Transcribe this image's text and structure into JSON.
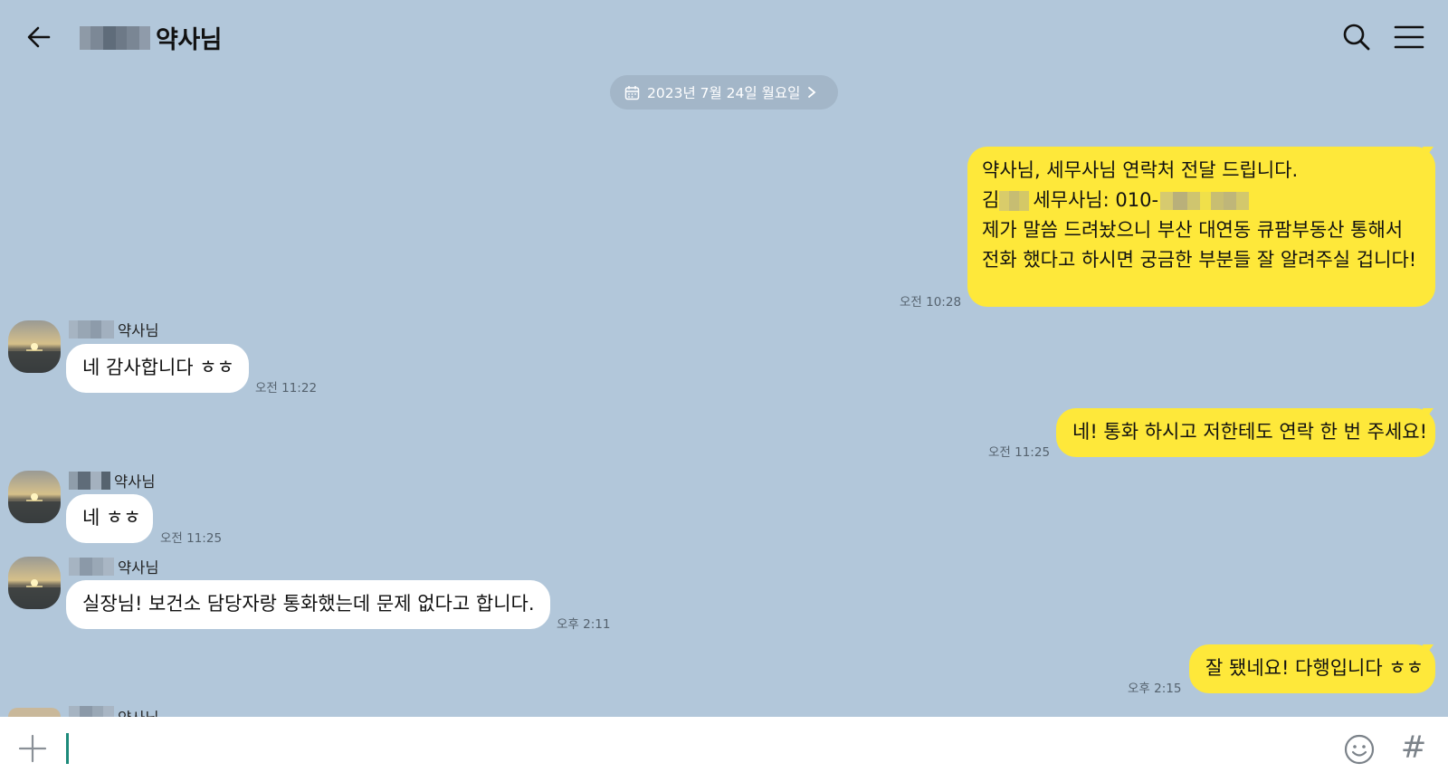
{
  "header": {
    "title": "약사님",
    "back_icon": "arrow-left-icon",
    "search_icon": "search-icon",
    "menu_icon": "hamburger-menu-icon"
  },
  "date_chip": {
    "label": "2023년 7월 24일 월요일",
    "icon": "calendar-icon"
  },
  "colors": {
    "background": "#b2c7da",
    "outgoing_bubble": "#fee83a",
    "incoming_bubble": "#ffffff",
    "time_text": "#55626e"
  },
  "messages": [
    {
      "side": "out",
      "lines": [
        "약사님, 세무사님 연락처 전달 드립니다.",
        "김",
        "세무사님: 010-",
        "제가 말씀 드려놨으니 부산 대연동 큐팜부동산 통해서",
        "전화 했다고 하시면 궁금한 부분들 잘 알려주실 겁니다!"
      ],
      "time": "오전 10:28"
    },
    {
      "side": "in",
      "sender": "약사님",
      "text": "네 감사합니다 ㅎㅎ",
      "time": "오전 11:22"
    },
    {
      "side": "out",
      "text": "네! 통화 하시고 저한테도 연락 한 번 주세요!",
      "time": "오전 11:25"
    },
    {
      "side": "in",
      "sender": "약사님",
      "text": "네 ㅎㅎ",
      "time": "오전 11:25"
    },
    {
      "side": "in",
      "sender": "약사님",
      "text": "실장님! 보건소 담당자랑 통화했는데 문제 없다고 합니다.",
      "time": "오후 2:11"
    },
    {
      "side": "out",
      "text": "잘 됐네요! 다행입니다 ㅎㅎ",
      "time": "오후 2:15"
    },
    {
      "side": "in",
      "sender": "약사님"
    }
  ],
  "input_bar": {
    "placeholder": "",
    "plus_icon": "plus-icon",
    "emoji_icon": "emoji-icon",
    "hash_icon": "#"
  }
}
